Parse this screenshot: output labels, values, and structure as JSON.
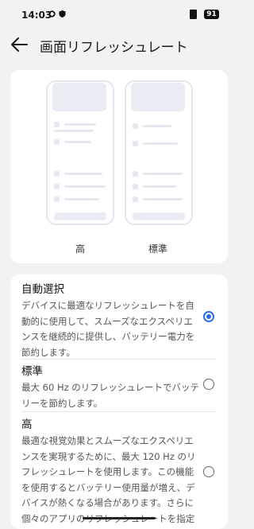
{
  "status_bar": {
    "time": "14:03",
    "battery": "91"
  },
  "header": {
    "title": "画面リフレッシュレート"
  },
  "preview": {
    "labels": [
      "高",
      "標準"
    ]
  },
  "options": [
    {
      "title": "自動選択",
      "desc": "デバイスに最適なリフレッシュレートを自動的に使用して、スムーズなエクスペリエンスを継続的に提供し、バッテリー電力を節約します。",
      "selected": true
    },
    {
      "title": "標準",
      "desc": "最大 60 Hz のリフレッシュレートでバッテリーを節約します。",
      "selected": false
    },
    {
      "title": "高",
      "desc": "最適な視覚効果とスムーズなエクスペリエンスを実現するために、最大 120 Hz のリフレッシュレートを使用します。この機能を使用するとバッテリー使用量が増え、デバイスが熱くなる場合があります。さらに個々のアプリのリフレッシュレートを指定できます。",
      "selected": false
    }
  ],
  "colors": {
    "accent": "#2d6cf0",
    "background": "#f2f2f2"
  }
}
